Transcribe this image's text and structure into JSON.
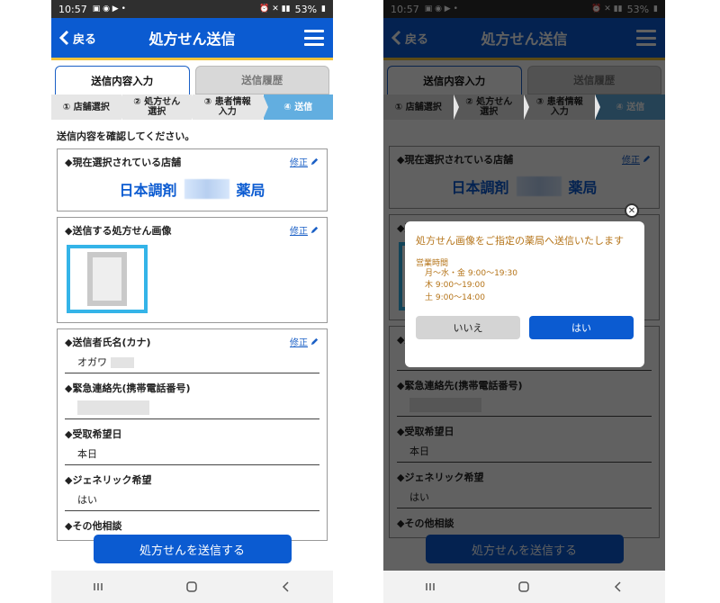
{
  "status": {
    "time": "10:57",
    "battery": "53%"
  },
  "appbar": {
    "back_label": "戻る",
    "title": "処方せん送信"
  },
  "tabs": [
    {
      "label": "送信内容入力"
    },
    {
      "label": "送信履歴"
    }
  ],
  "steps": [
    {
      "label": "① 店舗選択"
    },
    {
      "label_line1": "② 処方せん",
      "label_line2": "選択"
    },
    {
      "label_line1": "③ 患者情報",
      "label_line2": "入力"
    },
    {
      "label": "④ 送信"
    }
  ],
  "intro": "送信内容を確認してください。",
  "edit_label": "修正",
  "store": {
    "title": "◆現在選択されている店舗",
    "name_prefix": "日本調剤",
    "name_suffix": "薬局"
  },
  "image_card": {
    "title": "◆送信する処方せん画像"
  },
  "fields": [
    {
      "label": "◆送信者氏名(カナ)",
      "value": "オガワ"
    },
    {
      "label": "◆緊急連絡先(携帯電話番号)",
      "value": ""
    },
    {
      "label": "◆受取希望日",
      "value": "本日"
    },
    {
      "label": "◆ジェネリック希望",
      "value": "はい"
    },
    {
      "label": "◆その他相談",
      "value": ""
    }
  ],
  "submit_label": "処方せんを送信する",
  "dialog": {
    "message": "処方せん画像をご指定の薬局へ送信いたします",
    "hours_title": "営業時間",
    "hours": [
      "月〜水・金 9:00〜19:30",
      "木 9:00〜19:00",
      "土 9:00〜14:00"
    ],
    "no_label": "いいえ",
    "yes_label": "はい"
  },
  "colors": {
    "primary": "#0b5bd1",
    "accent": "#f0c33c",
    "step_current": "#62aee0",
    "dialog_text": "#b57419"
  }
}
